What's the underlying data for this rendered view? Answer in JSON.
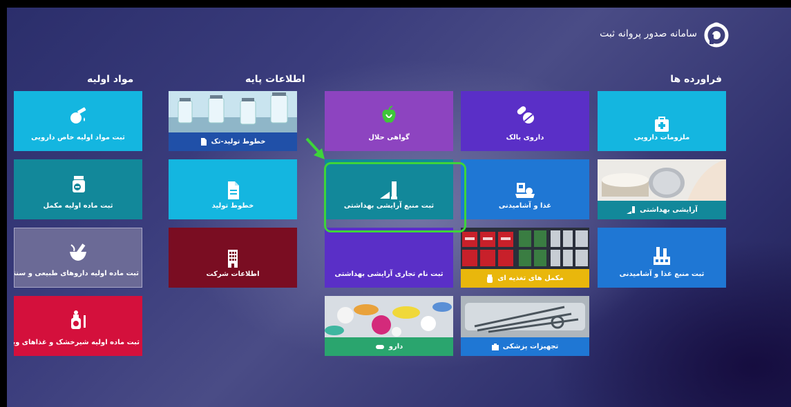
{
  "header": {
    "title": "سامانه صدور پروانه ثبت"
  },
  "sections": {
    "imports": "فراورده ها",
    "base_info": "اطلاعات پایه",
    "raw_materials": "مواد اولیه"
  },
  "tiles": {
    "medical_supplies": "ملزومات دارویی",
    "bulk_drug": "داروی بالک",
    "halal": "گواهی حلال",
    "production_lines_single": "خطوط تولید-تک",
    "special_raw_material": "ثبت مواد اولیه خاص دارویی",
    "cosmetics": "آرایشی بهداشتی",
    "food_beverage": "غذا و آشامیدنی",
    "cosmetic_source": "ثبت منبع آرایشی بهداشتی",
    "production_lines": "خطوط تولید",
    "supplement_raw": "ثبت ماده اولیه مکمل",
    "food_source": "ثبت منبع غذا و آشامیدنی",
    "nutritional_supplements": "مکمل های تغذیه ای",
    "cosmetic_brand": "ثبت نام تجاری آرایشی بهداشتی",
    "company_info": "اطلاعات شرکت",
    "herbal_raw": "ثبت ماده اولیه داروهای طبیعی و سنتی",
    "medical_equipment": "تجهیزات پزشکی",
    "drug": "دارو",
    "infant_formula_raw": "ثبت ماده اولیه شیرخشک و غذاهای ویژه"
  },
  "colors": {
    "cyan": "#14b6e0",
    "teal": "#12889a",
    "purple_light": "#8d44c0",
    "purple": "#5a2fc7",
    "blue": "#1f77d4",
    "navy_strip": "#2050a8",
    "yellow_strip": "#e9b70c",
    "green_strip": "#2aa56e",
    "maroon": "#7a0d22",
    "red": "#d4103c",
    "gray_purple": "#6b6a96",
    "highlight": "#3ed43a"
  },
  "icons": {
    "logo": "app-logo",
    "medical_supplies": "first-aid-kit-icon",
    "bulk_drug": "pills-icon",
    "halal": "apple-icon",
    "special_raw_material": "flask-drop-icon",
    "cosmetic_source": "cosmetics-tube-icon",
    "food_beverage": "food-tray-icon",
    "production_lines": "document-icon",
    "supplement_raw": "supplement-jar-icon",
    "food_source": "factory-icon",
    "company_info": "building-icon",
    "herbal_raw": "mortar-pestle-icon",
    "infant_formula_raw": "baby-bottle-icon"
  }
}
